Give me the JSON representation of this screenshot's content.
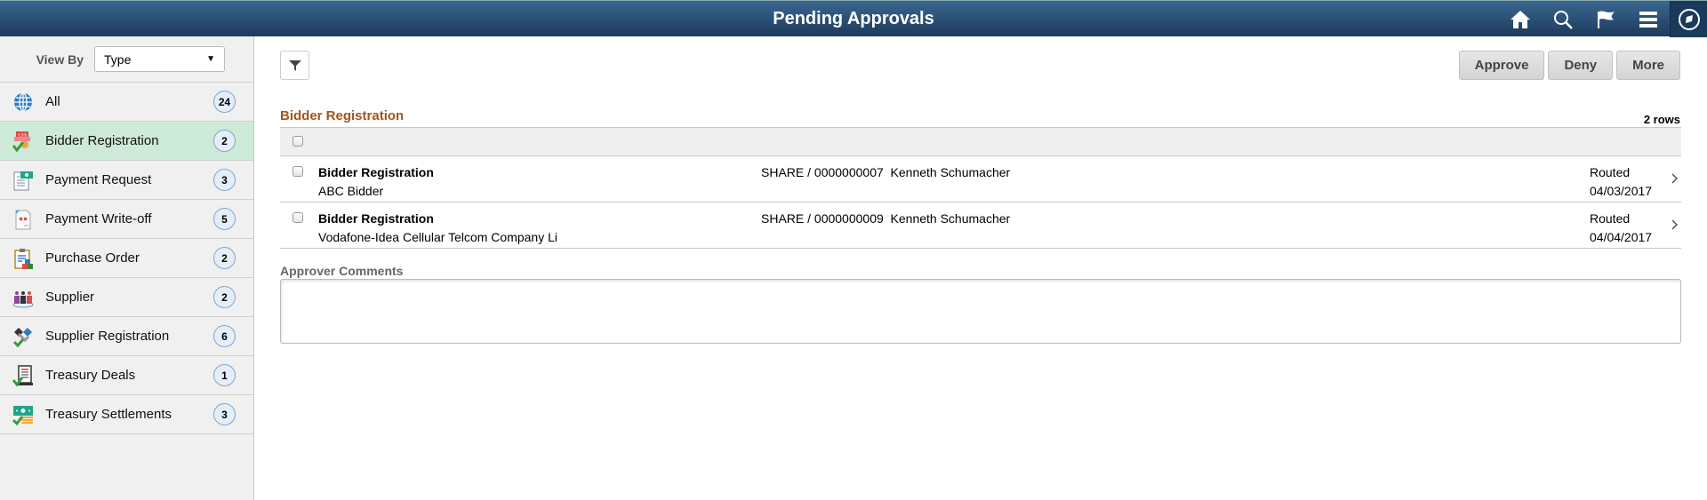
{
  "banner": {
    "title": "Pending Approvals",
    "icons": [
      "home-icon",
      "search-icon",
      "flag-icon",
      "menu-icon",
      "navbar-compass-icon"
    ]
  },
  "sidebar": {
    "view_by_label": "View By",
    "view_by_value": "Type",
    "items": [
      {
        "label": "All",
        "count": "24",
        "icon": "globe-icon"
      },
      {
        "label": "Bidder Registration",
        "count": "2",
        "icon": "bidder-registration-icon",
        "selected": true
      },
      {
        "label": "Payment Request",
        "count": "3",
        "icon": "payment-request-icon"
      },
      {
        "label": "Payment Write-off",
        "count": "5",
        "icon": "payment-writeoff-icon"
      },
      {
        "label": "Purchase Order",
        "count": "2",
        "icon": "purchase-order-icon"
      },
      {
        "label": "Supplier",
        "count": "2",
        "icon": "supplier-icon"
      },
      {
        "label": "Supplier Registration",
        "count": "6",
        "icon": "supplier-registration-icon"
      },
      {
        "label": "Treasury Deals",
        "count": "1",
        "icon": "treasury-deals-icon"
      },
      {
        "label": "Treasury Settlements",
        "count": "3",
        "icon": "treasury-settlements-icon"
      }
    ]
  },
  "main": {
    "buttons": {
      "approve": "Approve",
      "deny": "Deny",
      "more": "More"
    },
    "section_title": "Bidder Registration",
    "row_count": "2 rows",
    "rows": [
      {
        "title": "Bidder Registration",
        "subtitle": "ABC Bidder",
        "reference": "SHARE / 0000000007  Kenneth Schumacher",
        "status": "Routed",
        "date": "04/03/2017"
      },
      {
        "title": "Bidder Registration",
        "subtitle": "Vodafone-Idea Cellular Telcom Company Li",
        "reference": "SHARE / 0000000009  Kenneth Schumacher",
        "status": "Routed",
        "date": "04/04/2017"
      }
    ],
    "comments_label": "Approver Comments",
    "comments_value": ""
  },
  "colors": {
    "banner_top": "#3b6790",
    "banner_bottom": "#1d3b5c",
    "section_title": "#a0551c",
    "selected_item": "#cde9d7"
  }
}
